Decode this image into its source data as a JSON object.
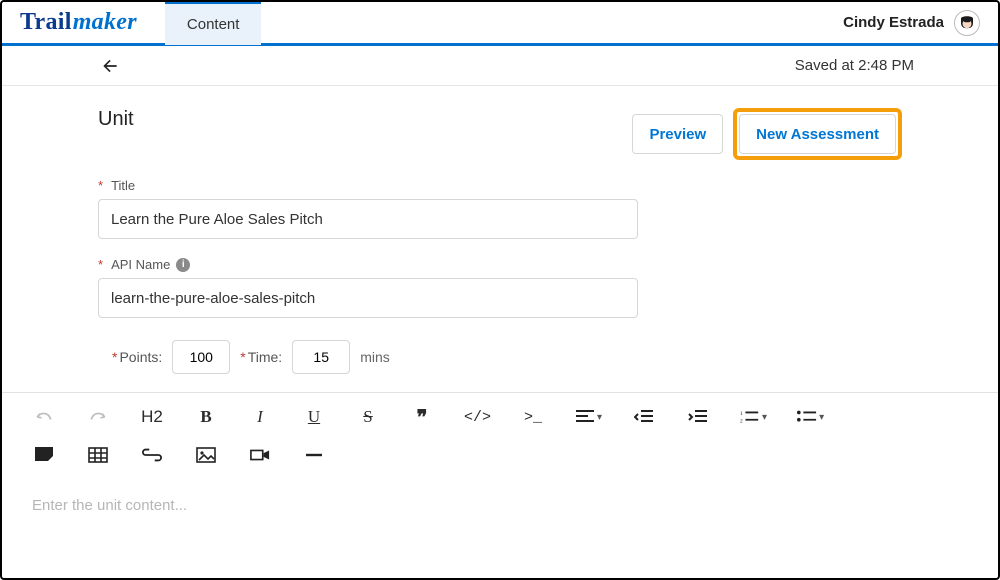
{
  "brand": {
    "part1": "Trail",
    "part2": "maker"
  },
  "tab": {
    "content": "Content"
  },
  "user": {
    "name": "Cindy Estrada"
  },
  "subheader": {
    "saved": "Saved at 2:48 PM"
  },
  "unit": {
    "heading": "Unit",
    "preview": "Preview",
    "new_assessment": "New Assessment"
  },
  "form": {
    "title_label": "Title",
    "title_value": "Learn the Pure Aloe Sales Pitch",
    "api_label": "API Name",
    "api_value": "learn-the-pure-aloe-sales-pitch",
    "points_label": "Points:",
    "points_value": "100",
    "time_label": "Time:",
    "time_value": "15",
    "mins": "mins",
    "required_marker": "*"
  },
  "editor": {
    "placeholder": "Enter the unit content...",
    "h2": "H2",
    "bold": "B",
    "italic": "I",
    "underline": "U",
    "strike": "S",
    "quote": "❞",
    "code": "</>",
    "terminal": ">_"
  }
}
